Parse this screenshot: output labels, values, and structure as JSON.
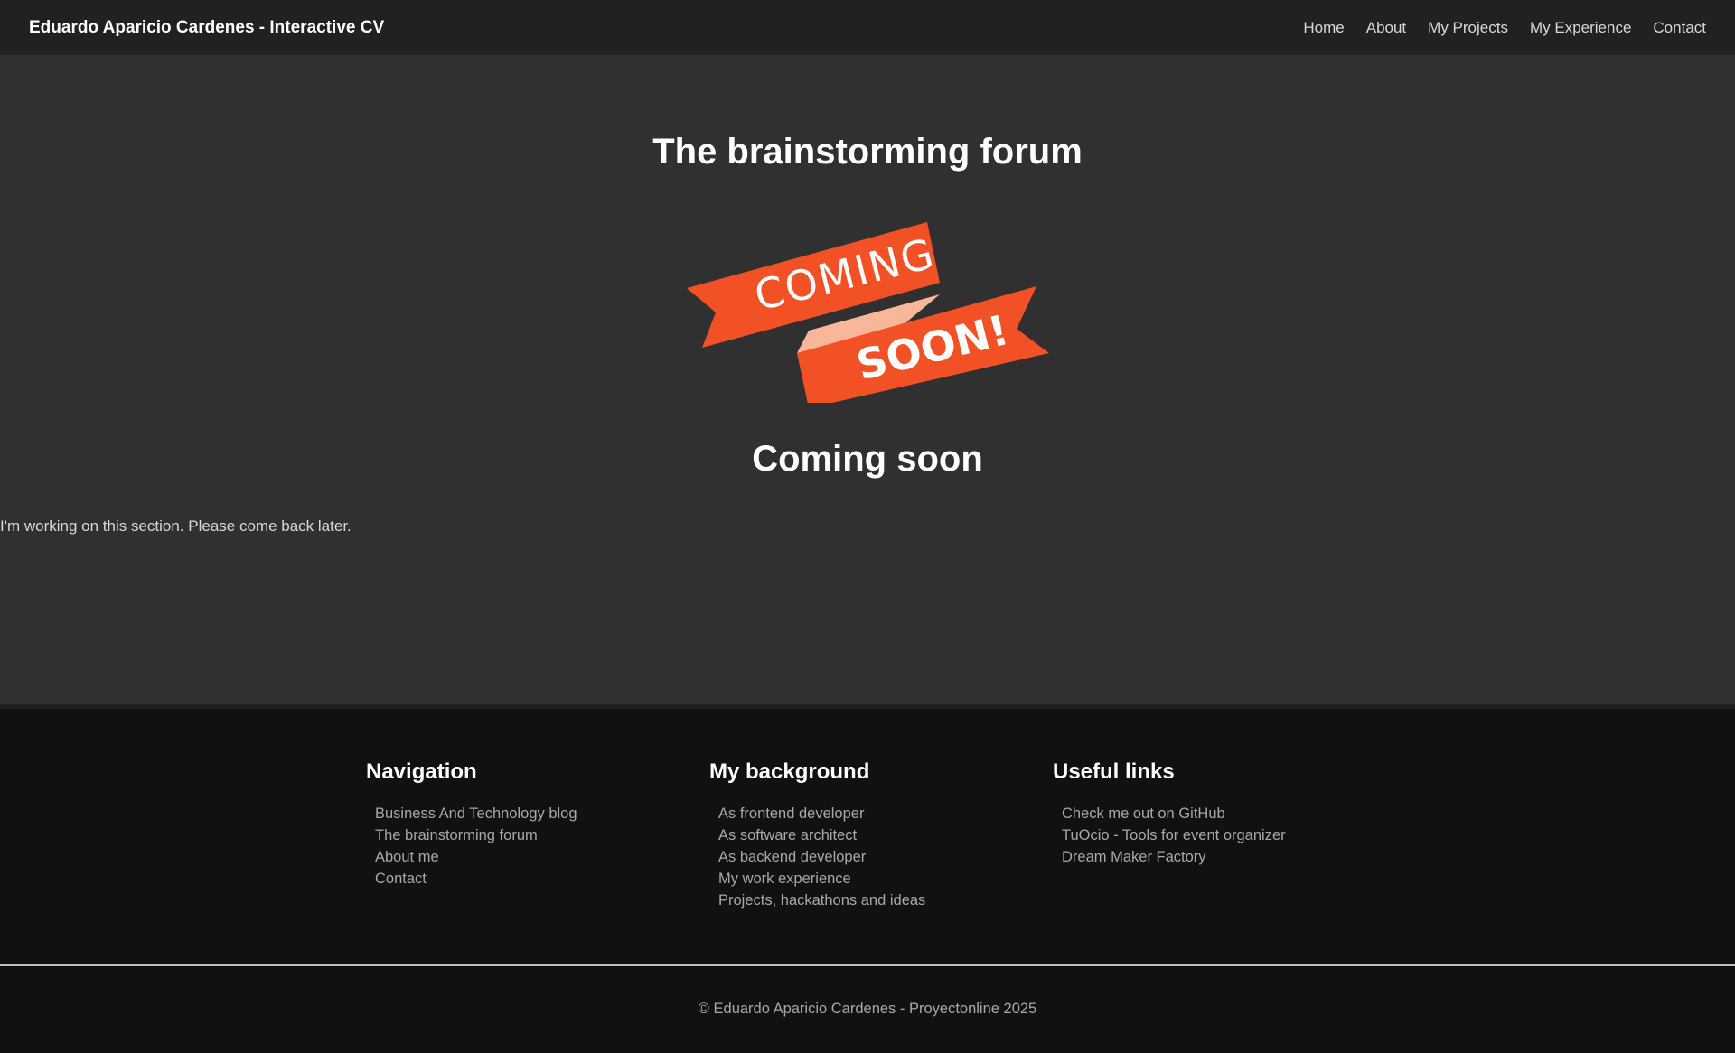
{
  "header": {
    "brand": "Eduardo Aparicio Cardenes - Interactive CV",
    "nav": [
      "Home",
      "About",
      "My Projects",
      "My Experience",
      "Contact"
    ]
  },
  "main": {
    "title": "The brainstorming forum",
    "banner": {
      "top_word": "COMING",
      "bottom_word": "SOON!",
      "ribbon_color": "#f15125",
      "fold_color": "#f9b79a"
    },
    "status_title": "Coming soon",
    "message": "I'm working on this section. Please come back later."
  },
  "footer": {
    "columns": [
      {
        "title": "Navigation",
        "links": [
          "Business And Technology blog",
          "The brainstorming forum",
          "About me",
          "Contact"
        ]
      },
      {
        "title": "My background",
        "links": [
          "As frontend developer",
          "As software architect",
          "As backend developer",
          "My work experience",
          "Projects, hackathons and ideas"
        ]
      },
      {
        "title": "Useful links",
        "links": [
          "Check me out on GitHub",
          "TuOcio - Tools for event organizer",
          "Dream Maker Factory"
        ]
      }
    ],
    "copyright": "© Eduardo Aparicio Cardenes - Proyectonline 2025"
  },
  "colors": {
    "header_bg": "#212121",
    "main_bg": "#303030",
    "footer_bg": "#111111",
    "accent": "#f15125"
  }
}
